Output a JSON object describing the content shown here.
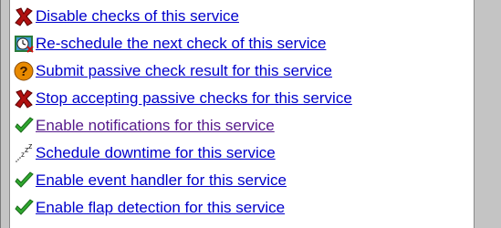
{
  "commands": [
    {
      "label": "Disable checks of this service",
      "icon": "disable-x-icon",
      "visited": false
    },
    {
      "label": "Re-schedule the next check of this service",
      "icon": "reschedule-clock-icon",
      "visited": false
    },
    {
      "label": "Submit passive check result for this service",
      "icon": "question-mark-icon",
      "visited": false
    },
    {
      "label": "Stop accepting passive checks for this service",
      "icon": "disable-x-icon",
      "visited": false
    },
    {
      "label": "Enable notifications for this service",
      "icon": "enable-checkmark-icon",
      "visited": true
    },
    {
      "label": "Schedule downtime for this service",
      "icon": "sleep-zzz-icon",
      "visited": false
    },
    {
      "label": "Enable event handler for this service",
      "icon": "enable-checkmark-icon",
      "visited": false
    },
    {
      "label": "Enable flap detection for this service",
      "icon": "enable-checkmark-icon",
      "visited": false
    }
  ],
  "colors": {
    "link": "#0000cc",
    "visited_link": "#551a8b",
    "panel_bg": "#c4c4c4",
    "x_red": "#b01010",
    "check_green": "#2fa82f",
    "question_orange": "#e88a00"
  }
}
